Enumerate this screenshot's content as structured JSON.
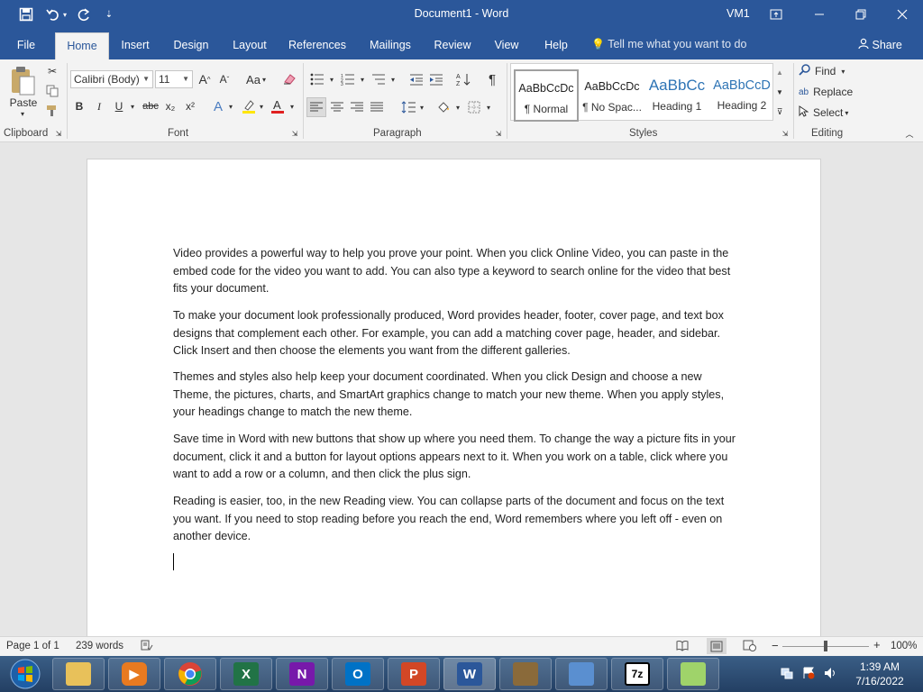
{
  "titlebar": {
    "doc_title": "Document1 - Word",
    "user": "VM1",
    "icons": [
      "save-icon",
      "undo-icon",
      "redo-icon",
      "customize-qat-icon",
      "ribbon-display-icon",
      "minimize-icon",
      "restore-icon",
      "close-icon"
    ]
  },
  "tabs": [
    "File",
    "Home",
    "Insert",
    "Design",
    "Layout",
    "References",
    "Mailings",
    "Review",
    "View",
    "Help"
  ],
  "active_tab": "Home",
  "tell_me": "Tell me what you want to do",
  "share": "Share",
  "ribbon": {
    "clipboard": {
      "paste": "Paste",
      "label": "Clipboard"
    },
    "font": {
      "name": "Calibri (Body)",
      "size": "11",
      "case": "Aa",
      "bold": "B",
      "italic": "I",
      "underline": "U",
      "strike": "abc",
      "sub": "x₂",
      "sup": "x²",
      "label": "Font"
    },
    "paragraph": {
      "label": "Paragraph"
    },
    "styles": {
      "items": [
        {
          "sample": "AaBbCcDc",
          "name": "¶ Normal"
        },
        {
          "sample": "AaBbCcDc",
          "name": "¶ No Spac..."
        },
        {
          "sample": "AaBbCc",
          "name": "Heading 1"
        },
        {
          "sample": "AaBbCcD",
          "name": "Heading 2"
        }
      ],
      "label": "Styles"
    },
    "editing": {
      "find": "Find",
      "replace": "Replace",
      "select": "Select",
      "label": "Editing"
    }
  },
  "document": {
    "paragraphs": [
      "Video provides a powerful way to help you prove your point. When you click Online Video, you can paste in the embed code for the video you want to add. You can also type a keyword to search online for the video that best fits your document.",
      "To make your document look professionally produced, Word provides header, footer, cover page, and text box designs that complement each other. For example, you can add a matching cover page, header, and sidebar. Click Insert and then choose the elements you want from the different galleries.",
      "Themes and styles also help keep your document coordinated. When you click Design and choose a new Theme, the pictures, charts, and SmartArt graphics change to match your new theme. When you apply styles, your headings change to match the new theme.",
      "Save time in Word with new buttons that show up where you need them. To change the way a picture fits in your document, click it and a button for layout options appears next to it. When you work on a table, click where you want to add a row or a column, and then click the plus sign.",
      "Reading is easier, too, in the new Reading view. You can collapse parts of the document and focus on the text you want. If you need to stop reading before you reach the end, Word remembers where you left off - even on another device."
    ]
  },
  "status": {
    "page": "Page 1 of 1",
    "words": "239 words",
    "zoom": "100%",
    "zoom_level": 1.0
  },
  "taskbar": {
    "apps": [
      "start",
      "file-explorer",
      "media-player",
      "chrome",
      "excel",
      "onenote",
      "outlook",
      "powerpoint",
      "word",
      "toolbox",
      "control-panel",
      "7zip",
      "notepad"
    ],
    "time": "1:39 AM",
    "date": "7/16/2022"
  },
  "colors": {
    "word_blue": "#2b579a",
    "ribbon_bg": "#f3f3f3"
  }
}
